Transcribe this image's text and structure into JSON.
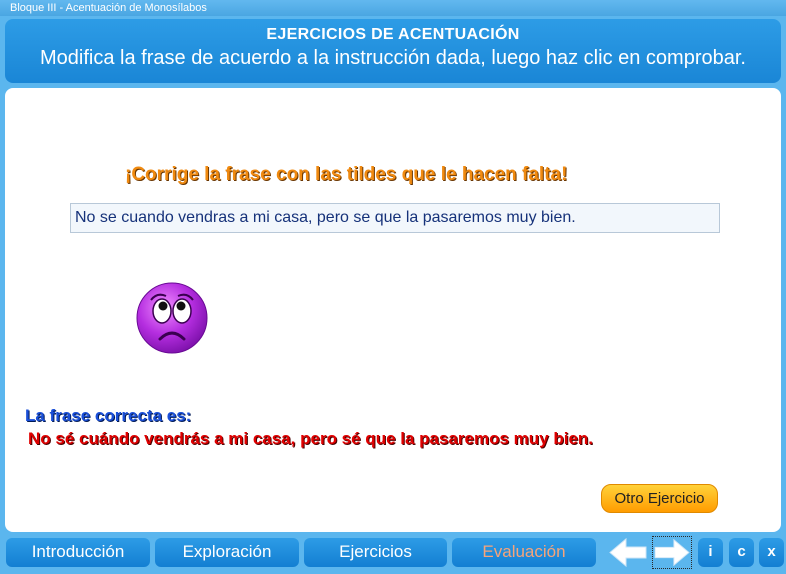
{
  "window": {
    "title": "Bloque III - Acentuación de Monosílabos"
  },
  "header": {
    "title": "EJERCICIOS DE ACENTUACIÓN",
    "instruction": "Modifica la frase de acuerdo a la instrucción dada, luego haz clic en comprobar."
  },
  "exercise": {
    "prompt": "¡Corrige la frase con las tildes que le hacen falta!",
    "sentence_value": "No se cuando vendras a mi casa, pero se que la pasaremos muy bien.",
    "feedback_icon": "sad-face-icon",
    "result_label": "La frase correcta es:",
    "correct_sentence": "No sé cuándo vendrás a mi casa, pero sé que la pasaremos muy bien.",
    "next_button": "Otro Ejercicio"
  },
  "nav": {
    "tabs": [
      {
        "label": "Introducción"
      },
      {
        "label": "Exploración"
      },
      {
        "label": "Ejercicios"
      },
      {
        "label": "Evaluación"
      }
    ],
    "active_tab": "Evaluación",
    "back_icon": "arrow-left-icon",
    "forward_icon": "arrow-right-icon",
    "info_label": "i",
    "credits_label": "c",
    "close_label": "x"
  },
  "colors": {
    "background": "#5bb6ee",
    "header": "#1f8fdc",
    "prompt": "#f08a10",
    "result_label": "#1a4fd8",
    "correct_sentence": "#e00000",
    "button": "#ffb300",
    "active_tab_text": "#f7a47a"
  }
}
